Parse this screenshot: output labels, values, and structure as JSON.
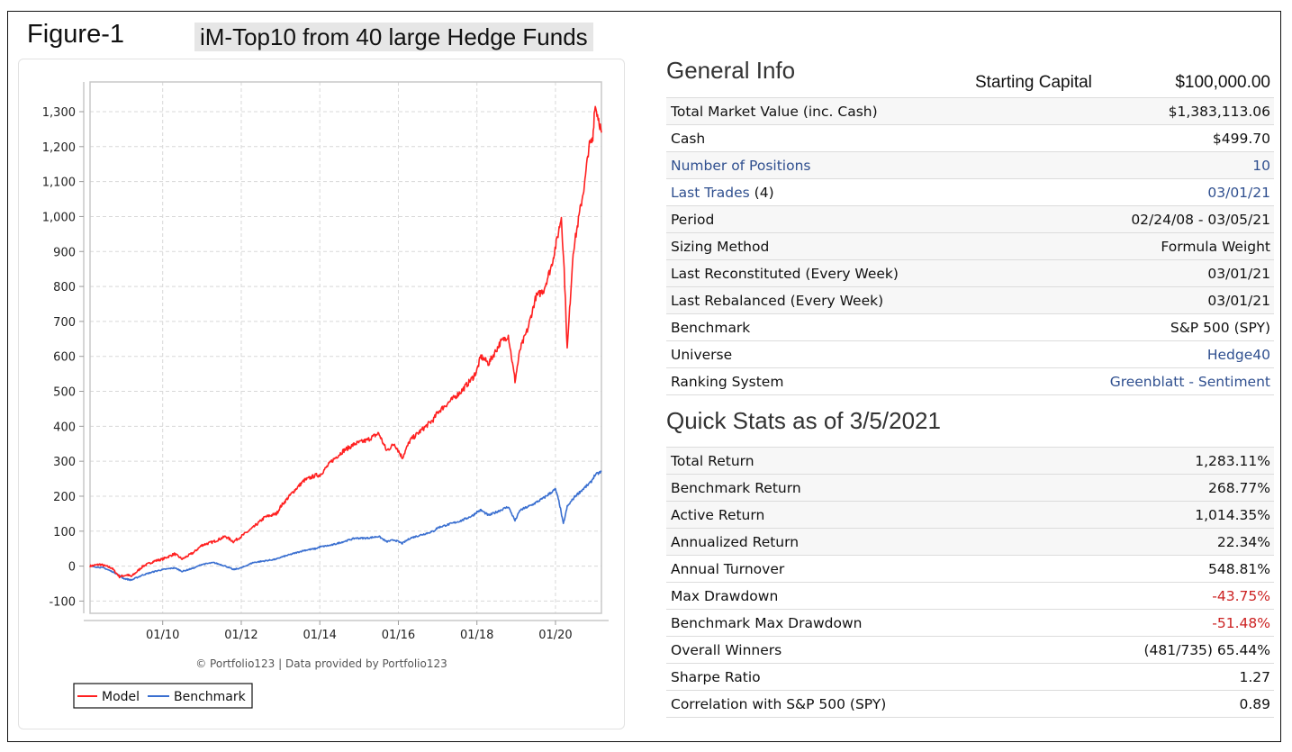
{
  "figure": {
    "label": "Figure-1",
    "title": "iM-Top10 from 40 large Hedge Funds"
  },
  "general_info": {
    "title": "General Info",
    "starting_capital_label": "Starting Capital",
    "starting_capital_value": "$100,000.00",
    "rows": [
      {
        "label": "Total Market Value (inc. Cash)",
        "value": "$1,383,113.06"
      },
      {
        "label": "Cash",
        "value": "$499.70"
      },
      {
        "label": "Number of Positions",
        "value": "10"
      },
      {
        "label": "Last Trades",
        "label_suffix": " (4)",
        "value": "03/01/21"
      },
      {
        "label": "Period",
        "value": "02/24/08 - 03/05/21"
      },
      {
        "label": "Sizing Method",
        "value": "Formula Weight"
      },
      {
        "label": "Last Reconstituted (Every Week)",
        "value": "03/01/21"
      },
      {
        "label": "Last Rebalanced (Every Week)",
        "value": "03/01/21"
      },
      {
        "label": "Benchmark",
        "value": "S&P 500 (SPY)"
      },
      {
        "label": "Universe",
        "value": "Hedge40"
      },
      {
        "label": "Ranking System",
        "value": "Greenblatt - Sentiment"
      }
    ]
  },
  "quick_stats": {
    "title": "Quick Stats as of 3/5/2021",
    "rows": [
      {
        "label": "Total Return",
        "value": "1,283.11%"
      },
      {
        "label": "Benchmark Return",
        "value": "268.77%"
      },
      {
        "label": "Active Return",
        "value": "1,014.35%"
      },
      {
        "label": "Annualized Return",
        "value": "22.34%"
      },
      {
        "label": "Annual Turnover",
        "value": "548.81%"
      },
      {
        "label": "Max Drawdown",
        "value": "-43.75%"
      },
      {
        "label": "Benchmark Max Drawdown",
        "value": "-51.48%"
      },
      {
        "label": "Overall Winners",
        "value": "(481/735) 65.44%"
      },
      {
        "label": "Sharpe Ratio",
        "value": "1.27"
      },
      {
        "label": "Correlation with S&P 500 (SPY)",
        "value": "0.89"
      }
    ]
  },
  "colors": {
    "model": "#ff2020",
    "benchmark": "#3a6fd0",
    "link": "#2f4f8f",
    "negative": "#cc2222"
  },
  "chart_data": {
    "type": "line",
    "title": "",
    "xlabel": "",
    "ylabel": "",
    "credit": "© Portfolio123 | Data provided by Portfolio123",
    "x_ticks": [
      "01/10",
      "01/12",
      "01/14",
      "01/16",
      "01/18",
      "01/20"
    ],
    "x_tick_years": [
      2010,
      2012,
      2014,
      2016,
      2018,
      2020
    ],
    "xlim": [
      2008.15,
      2021.17
    ],
    "y_ticks": [
      -100,
      0,
      100,
      200,
      300,
      400,
      500,
      600,
      700,
      800,
      900,
      1000,
      1100,
      1200,
      1300
    ],
    "y_tick_labels": [
      "-100",
      "0",
      "100",
      "200",
      "300",
      "400",
      "500",
      "600",
      "700",
      "800",
      "900",
      "1,000",
      "1,100",
      "1,200",
      "1,300"
    ],
    "ylim": [
      -135,
      1385
    ],
    "grid": true,
    "legend_position": "bottom-left",
    "series": [
      {
        "name": "Model",
        "x": [
          2008.15,
          2008.4,
          2008.7,
          2008.9,
          2009.1,
          2009.2,
          2009.5,
          2009.8,
          2010.0,
          2010.3,
          2010.5,
          2010.8,
          2011.0,
          2011.3,
          2011.6,
          2011.8,
          2012.0,
          2012.3,
          2012.6,
          2012.9,
          2013.0,
          2013.3,
          2013.6,
          2013.9,
          2014.0,
          2014.3,
          2014.6,
          2014.9,
          2015.2,
          2015.5,
          2015.7,
          2015.9,
          2016.1,
          2016.3,
          2016.6,
          2016.9,
          2017.0,
          2017.3,
          2017.6,
          2017.9,
          2018.0,
          2018.1,
          2018.3,
          2018.6,
          2018.8,
          2018.97,
          2019.1,
          2019.3,
          2019.5,
          2019.7,
          2019.9,
          2020.05,
          2020.15,
          2020.22,
          2020.3,
          2020.45,
          2020.6,
          2020.75,
          2020.85,
          2020.95,
          2021.0,
          2021.1,
          2021.17
        ],
        "y": [
          0,
          5,
          -5,
          -30,
          -25,
          -30,
          0,
          15,
          20,
          35,
          20,
          40,
          60,
          70,
          85,
          70,
          85,
          110,
          140,
          150,
          170,
          210,
          245,
          260,
          260,
          300,
          330,
          350,
          360,
          380,
          330,
          350,
          310,
          360,
          390,
          420,
          440,
          470,
          500,
          540,
          560,
          600,
          580,
          640,
          660,
          530,
          620,
          680,
          770,
          790,
          860,
          940,
          1000,
          850,
          620,
          900,
          1000,
          1100,
          1200,
          1220,
          1320,
          1280,
          1240
        ]
      },
      {
        "name": "Benchmark",
        "x": [
          2008.15,
          2008.5,
          2008.8,
          2009.0,
          2009.2,
          2009.5,
          2009.8,
          2010.0,
          2010.3,
          2010.5,
          2010.8,
          2011.0,
          2011.3,
          2011.6,
          2011.8,
          2012.0,
          2012.3,
          2012.6,
          2012.9,
          2013.0,
          2013.3,
          2013.6,
          2013.9,
          2014.0,
          2014.3,
          2014.6,
          2014.9,
          2015.2,
          2015.5,
          2015.7,
          2015.9,
          2016.1,
          2016.3,
          2016.6,
          2016.9,
          2017.0,
          2017.3,
          2017.6,
          2017.9,
          2018.0,
          2018.1,
          2018.3,
          2018.6,
          2018.8,
          2018.97,
          2019.1,
          2019.4,
          2019.7,
          2020.0,
          2020.1,
          2020.2,
          2020.3,
          2020.5,
          2020.7,
          2020.9,
          2021.0,
          2021.17
        ],
        "y": [
          0,
          -5,
          -20,
          -35,
          -40,
          -25,
          -15,
          -10,
          -5,
          -15,
          -5,
          5,
          10,
          0,
          -10,
          -5,
          10,
          15,
          20,
          25,
          35,
          45,
          50,
          55,
          60,
          70,
          80,
          80,
          85,
          70,
          75,
          65,
          80,
          90,
          100,
          110,
          120,
          130,
          145,
          155,
          160,
          145,
          160,
          170,
          130,
          160,
          175,
          195,
          220,
          180,
          120,
          170,
          200,
          220,
          240,
          260,
          270
        ]
      }
    ]
  }
}
